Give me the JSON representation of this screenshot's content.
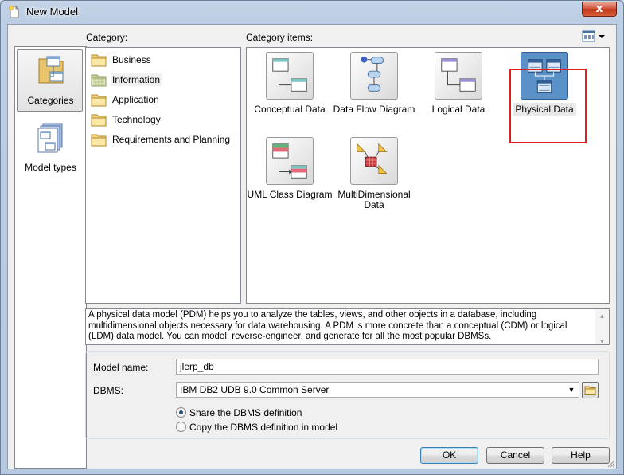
{
  "window": {
    "title": "New Model",
    "close_label": "x"
  },
  "nav": {
    "items": [
      {
        "label": "Categories",
        "icon": "categories-icon",
        "selected": true
      },
      {
        "label": "Model types",
        "icon": "model-types-icon",
        "selected": false
      }
    ]
  },
  "category": {
    "label": "Category:",
    "items": [
      {
        "label": "Business",
        "selected": false
      },
      {
        "label": "Information",
        "selected": true
      },
      {
        "label": "Application",
        "selected": false
      },
      {
        "label": "Technology",
        "selected": false
      },
      {
        "label": "Requirements and Planning",
        "selected": false
      }
    ]
  },
  "category_items": {
    "label": "Category items:",
    "items": [
      {
        "label": "Conceptual Data",
        "icon": "conceptual-data-icon"
      },
      {
        "label": "Data Flow Diagram",
        "icon": "data-flow-diagram-icon"
      },
      {
        "label": "Logical Data",
        "icon": "logical-data-icon"
      },
      {
        "label": "Physical Data",
        "icon": "physical-data-icon",
        "selected": true
      },
      {
        "label": "UML Class Diagram",
        "icon": "uml-class-diagram-icon"
      },
      {
        "label_line1": "MultiDimensional",
        "label_line2": "Data",
        "icon": "multidimensional-data-icon"
      }
    ]
  },
  "description": "A physical data model (PDM) helps you to analyze the tables, views, and other objects in a database, including multidimensional objects necessary for data warehousing. A PDM is more concrete than a conceptual (CDM) or logical (LDM) data model. You can model, reverse-engineer, and generate for all the most popular DBMSs.",
  "form": {
    "model_name_label": "Model name:",
    "model_name_value": "jlerp_db",
    "dbms_label": "DBMS:",
    "dbms_value": "IBM DB2 UDB 9.0 Common Server",
    "radio_share": "Share the DBMS definition",
    "radio_copy": "Copy the DBMS definition in model",
    "selected_radio": "share"
  },
  "buttons": {
    "ok": "OK",
    "cancel": "Cancel",
    "help": "Help"
  },
  "colors": {
    "highlight": "#e02020",
    "selection_icon": "#5b91c9"
  }
}
